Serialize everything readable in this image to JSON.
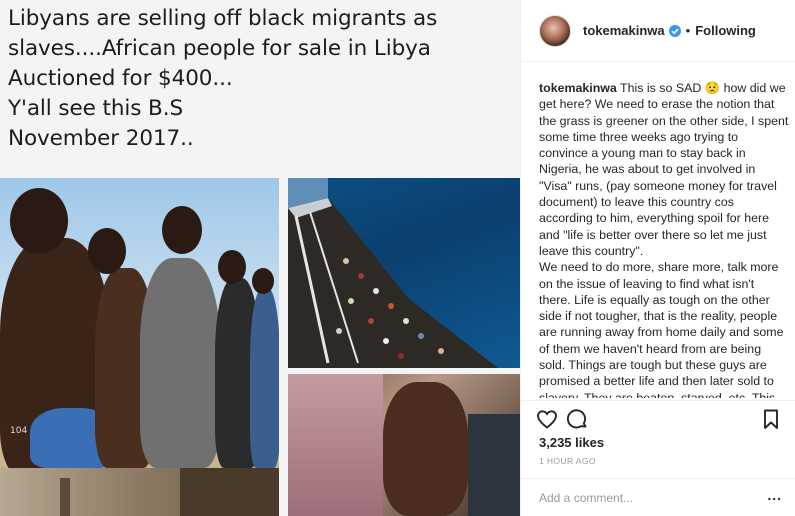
{
  "image": {
    "caption_lines": "Libyans are selling off black migrants as\nslaves....African people for sale in Libya\nAuctioned for $400...\nY'all see this B.S\nNovember 2017..",
    "watermark": "104"
  },
  "header": {
    "username": "tokemakinwa",
    "separator": "•",
    "follow_status": "Following"
  },
  "comment": {
    "author": "tokemakinwa",
    "body": " This is so SAD 😟 how did we get here? We need to erase the notion that the grass is greener on the other side, I spent some time three weeks ago trying to convince a young man to stay back in Nigeria, he was about to get involved in \"Visa\" runs, (pay someone money for travel document) to leave this country cos according to him, everything spoil for here and \"life is better over there so let me just leave this country\".\nWe need to do more, share more, talk more on the issue of leaving to find what isn't there. Life is equally as tough on the other side if not tougher, that is the reality, people are running away from home daily and some of them we haven't heard from are being sold. Things are tough but these guys are promised a better life and then later sold to slavery. They are beaten, starved, etc. This must stop ☝"
  },
  "stats": {
    "likes": "3,235 likes",
    "time": "1 HOUR AGO"
  },
  "add_comment": {
    "placeholder": "Add a comment...",
    "more": "..."
  },
  "icons": [
    "heart-icon",
    "comment-icon",
    "bookmark-icon",
    "verified-badge-icon"
  ],
  "colors": {
    "verified": "#3897f0",
    "border": "#efefef",
    "muted": "#999999",
    "text": "#262626"
  }
}
